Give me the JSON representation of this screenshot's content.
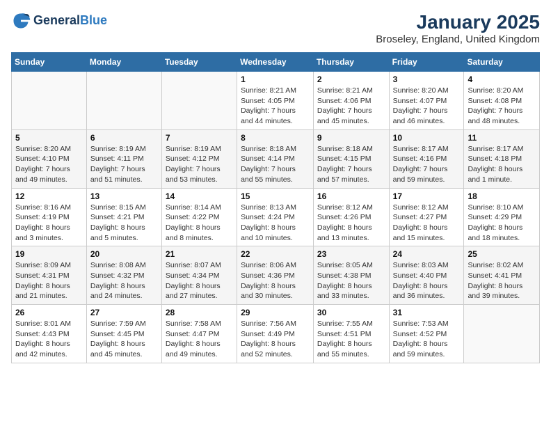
{
  "header": {
    "logo_line1": "General",
    "logo_line2": "Blue",
    "title": "January 2025",
    "subtitle": "Broseley, England, United Kingdom"
  },
  "weekdays": [
    "Sunday",
    "Monday",
    "Tuesday",
    "Wednesday",
    "Thursday",
    "Friday",
    "Saturday"
  ],
  "weeks": [
    [
      {
        "day": "",
        "sunrise": "",
        "sunset": "",
        "daylight": ""
      },
      {
        "day": "",
        "sunrise": "",
        "sunset": "",
        "daylight": ""
      },
      {
        "day": "",
        "sunrise": "",
        "sunset": "",
        "daylight": ""
      },
      {
        "day": "1",
        "sunrise": "Sunrise: 8:21 AM",
        "sunset": "Sunset: 4:05 PM",
        "daylight": "Daylight: 7 hours and 44 minutes."
      },
      {
        "day": "2",
        "sunrise": "Sunrise: 8:21 AM",
        "sunset": "Sunset: 4:06 PM",
        "daylight": "Daylight: 7 hours and 45 minutes."
      },
      {
        "day": "3",
        "sunrise": "Sunrise: 8:20 AM",
        "sunset": "Sunset: 4:07 PM",
        "daylight": "Daylight: 7 hours and 46 minutes."
      },
      {
        "day": "4",
        "sunrise": "Sunrise: 8:20 AM",
        "sunset": "Sunset: 4:08 PM",
        "daylight": "Daylight: 7 hours and 48 minutes."
      }
    ],
    [
      {
        "day": "5",
        "sunrise": "Sunrise: 8:20 AM",
        "sunset": "Sunset: 4:10 PM",
        "daylight": "Daylight: 7 hours and 49 minutes."
      },
      {
        "day": "6",
        "sunrise": "Sunrise: 8:19 AM",
        "sunset": "Sunset: 4:11 PM",
        "daylight": "Daylight: 7 hours and 51 minutes."
      },
      {
        "day": "7",
        "sunrise": "Sunrise: 8:19 AM",
        "sunset": "Sunset: 4:12 PM",
        "daylight": "Daylight: 7 hours and 53 minutes."
      },
      {
        "day": "8",
        "sunrise": "Sunrise: 8:18 AM",
        "sunset": "Sunset: 4:14 PM",
        "daylight": "Daylight: 7 hours and 55 minutes."
      },
      {
        "day": "9",
        "sunrise": "Sunrise: 8:18 AM",
        "sunset": "Sunset: 4:15 PM",
        "daylight": "Daylight: 7 hours and 57 minutes."
      },
      {
        "day": "10",
        "sunrise": "Sunrise: 8:17 AM",
        "sunset": "Sunset: 4:16 PM",
        "daylight": "Daylight: 7 hours and 59 minutes."
      },
      {
        "day": "11",
        "sunrise": "Sunrise: 8:17 AM",
        "sunset": "Sunset: 4:18 PM",
        "daylight": "Daylight: 8 hours and 1 minute."
      }
    ],
    [
      {
        "day": "12",
        "sunrise": "Sunrise: 8:16 AM",
        "sunset": "Sunset: 4:19 PM",
        "daylight": "Daylight: 8 hours and 3 minutes."
      },
      {
        "day": "13",
        "sunrise": "Sunrise: 8:15 AM",
        "sunset": "Sunset: 4:21 PM",
        "daylight": "Daylight: 8 hours and 5 minutes."
      },
      {
        "day": "14",
        "sunrise": "Sunrise: 8:14 AM",
        "sunset": "Sunset: 4:22 PM",
        "daylight": "Daylight: 8 hours and 8 minutes."
      },
      {
        "day": "15",
        "sunrise": "Sunrise: 8:13 AM",
        "sunset": "Sunset: 4:24 PM",
        "daylight": "Daylight: 8 hours and 10 minutes."
      },
      {
        "day": "16",
        "sunrise": "Sunrise: 8:12 AM",
        "sunset": "Sunset: 4:26 PM",
        "daylight": "Daylight: 8 hours and 13 minutes."
      },
      {
        "day": "17",
        "sunrise": "Sunrise: 8:12 AM",
        "sunset": "Sunset: 4:27 PM",
        "daylight": "Daylight: 8 hours and 15 minutes."
      },
      {
        "day": "18",
        "sunrise": "Sunrise: 8:10 AM",
        "sunset": "Sunset: 4:29 PM",
        "daylight": "Daylight: 8 hours and 18 minutes."
      }
    ],
    [
      {
        "day": "19",
        "sunrise": "Sunrise: 8:09 AM",
        "sunset": "Sunset: 4:31 PM",
        "daylight": "Daylight: 8 hours and 21 minutes."
      },
      {
        "day": "20",
        "sunrise": "Sunrise: 8:08 AM",
        "sunset": "Sunset: 4:32 PM",
        "daylight": "Daylight: 8 hours and 24 minutes."
      },
      {
        "day": "21",
        "sunrise": "Sunrise: 8:07 AM",
        "sunset": "Sunset: 4:34 PM",
        "daylight": "Daylight: 8 hours and 27 minutes."
      },
      {
        "day": "22",
        "sunrise": "Sunrise: 8:06 AM",
        "sunset": "Sunset: 4:36 PM",
        "daylight": "Daylight: 8 hours and 30 minutes."
      },
      {
        "day": "23",
        "sunrise": "Sunrise: 8:05 AM",
        "sunset": "Sunset: 4:38 PM",
        "daylight": "Daylight: 8 hours and 33 minutes."
      },
      {
        "day": "24",
        "sunrise": "Sunrise: 8:03 AM",
        "sunset": "Sunset: 4:40 PM",
        "daylight": "Daylight: 8 hours and 36 minutes."
      },
      {
        "day": "25",
        "sunrise": "Sunrise: 8:02 AM",
        "sunset": "Sunset: 4:41 PM",
        "daylight": "Daylight: 8 hours and 39 minutes."
      }
    ],
    [
      {
        "day": "26",
        "sunrise": "Sunrise: 8:01 AM",
        "sunset": "Sunset: 4:43 PM",
        "daylight": "Daylight: 8 hours and 42 minutes."
      },
      {
        "day": "27",
        "sunrise": "Sunrise: 7:59 AM",
        "sunset": "Sunset: 4:45 PM",
        "daylight": "Daylight: 8 hours and 45 minutes."
      },
      {
        "day": "28",
        "sunrise": "Sunrise: 7:58 AM",
        "sunset": "Sunset: 4:47 PM",
        "daylight": "Daylight: 8 hours and 49 minutes."
      },
      {
        "day": "29",
        "sunrise": "Sunrise: 7:56 AM",
        "sunset": "Sunset: 4:49 PM",
        "daylight": "Daylight: 8 hours and 52 minutes."
      },
      {
        "day": "30",
        "sunrise": "Sunrise: 7:55 AM",
        "sunset": "Sunset: 4:51 PM",
        "daylight": "Daylight: 8 hours and 55 minutes."
      },
      {
        "day": "31",
        "sunrise": "Sunrise: 7:53 AM",
        "sunset": "Sunset: 4:52 PM",
        "daylight": "Daylight: 8 hours and 59 minutes."
      },
      {
        "day": "",
        "sunrise": "",
        "sunset": "",
        "daylight": ""
      }
    ]
  ]
}
